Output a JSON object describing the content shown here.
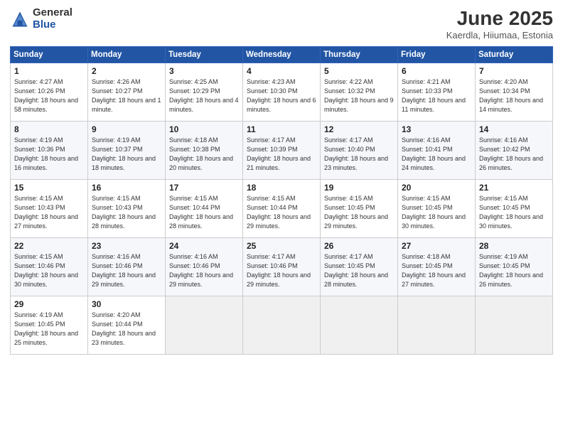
{
  "header": {
    "logo_general": "General",
    "logo_blue": "Blue",
    "month_title": "June 2025",
    "location": "Kaerdla, Hiiumaa, Estonia"
  },
  "weekdays": [
    "Sunday",
    "Monday",
    "Tuesday",
    "Wednesday",
    "Thursday",
    "Friday",
    "Saturday"
  ],
  "weeks": [
    [
      {
        "day": "1",
        "sunrise": "4:27 AM",
        "sunset": "10:26 PM",
        "daylight": "18 hours and 58 minutes."
      },
      {
        "day": "2",
        "sunrise": "4:26 AM",
        "sunset": "10:27 PM",
        "daylight": "18 hours and 1 minute."
      },
      {
        "day": "3",
        "sunrise": "4:25 AM",
        "sunset": "10:29 PM",
        "daylight": "18 hours and 4 minutes."
      },
      {
        "day": "4",
        "sunrise": "4:23 AM",
        "sunset": "10:30 PM",
        "daylight": "18 hours and 6 minutes."
      },
      {
        "day": "5",
        "sunrise": "4:22 AM",
        "sunset": "10:32 PM",
        "daylight": "18 hours and 9 minutes."
      },
      {
        "day": "6",
        "sunrise": "4:21 AM",
        "sunset": "10:33 PM",
        "daylight": "18 hours and 11 minutes."
      },
      {
        "day": "7",
        "sunrise": "4:20 AM",
        "sunset": "10:34 PM",
        "daylight": "18 hours and 14 minutes."
      }
    ],
    [
      {
        "day": "8",
        "sunrise": "4:19 AM",
        "sunset": "10:36 PM",
        "daylight": "18 hours and 16 minutes."
      },
      {
        "day": "9",
        "sunrise": "4:19 AM",
        "sunset": "10:37 PM",
        "daylight": "18 hours and 18 minutes."
      },
      {
        "day": "10",
        "sunrise": "4:18 AM",
        "sunset": "10:38 PM",
        "daylight": "18 hours and 20 minutes."
      },
      {
        "day": "11",
        "sunrise": "4:17 AM",
        "sunset": "10:39 PM",
        "daylight": "18 hours and 21 minutes."
      },
      {
        "day": "12",
        "sunrise": "4:17 AM",
        "sunset": "10:40 PM",
        "daylight": "18 hours and 23 minutes."
      },
      {
        "day": "13",
        "sunrise": "4:16 AM",
        "sunset": "10:41 PM",
        "daylight": "18 hours and 24 minutes."
      },
      {
        "day": "14",
        "sunrise": "4:16 AM",
        "sunset": "10:42 PM",
        "daylight": "18 hours and 26 minutes."
      }
    ],
    [
      {
        "day": "15",
        "sunrise": "4:15 AM",
        "sunset": "10:43 PM",
        "daylight": "18 hours and 27 minutes."
      },
      {
        "day": "16",
        "sunrise": "4:15 AM",
        "sunset": "10:43 PM",
        "daylight": "18 hours and 28 minutes."
      },
      {
        "day": "17",
        "sunrise": "4:15 AM",
        "sunset": "10:44 PM",
        "daylight": "18 hours and 28 minutes."
      },
      {
        "day": "18",
        "sunrise": "4:15 AM",
        "sunset": "10:44 PM",
        "daylight": "18 hours and 29 minutes."
      },
      {
        "day": "19",
        "sunrise": "4:15 AM",
        "sunset": "10:45 PM",
        "daylight": "18 hours and 29 minutes."
      },
      {
        "day": "20",
        "sunrise": "4:15 AM",
        "sunset": "10:45 PM",
        "daylight": "18 hours and 30 minutes."
      },
      {
        "day": "21",
        "sunrise": "4:15 AM",
        "sunset": "10:45 PM",
        "daylight": "18 hours and 30 minutes."
      }
    ],
    [
      {
        "day": "22",
        "sunrise": "4:15 AM",
        "sunset": "10:46 PM",
        "daylight": "18 hours and 30 minutes."
      },
      {
        "day": "23",
        "sunrise": "4:16 AM",
        "sunset": "10:46 PM",
        "daylight": "18 hours and 29 minutes."
      },
      {
        "day": "24",
        "sunrise": "4:16 AM",
        "sunset": "10:46 PM",
        "daylight": "18 hours and 29 minutes."
      },
      {
        "day": "25",
        "sunrise": "4:17 AM",
        "sunset": "10:46 PM",
        "daylight": "18 hours and 29 minutes."
      },
      {
        "day": "26",
        "sunrise": "4:17 AM",
        "sunset": "10:45 PM",
        "daylight": "18 hours and 28 minutes."
      },
      {
        "day": "27",
        "sunrise": "4:18 AM",
        "sunset": "10:45 PM",
        "daylight": "18 hours and 27 minutes."
      },
      {
        "day": "28",
        "sunrise": "4:19 AM",
        "sunset": "10:45 PM",
        "daylight": "18 hours and 26 minutes."
      }
    ],
    [
      {
        "day": "29",
        "sunrise": "4:19 AM",
        "sunset": "10:45 PM",
        "daylight": "18 hours and 25 minutes."
      },
      {
        "day": "30",
        "sunrise": "4:20 AM",
        "sunset": "10:44 PM",
        "daylight": "18 hours and 23 minutes."
      },
      null,
      null,
      null,
      null,
      null
    ]
  ]
}
